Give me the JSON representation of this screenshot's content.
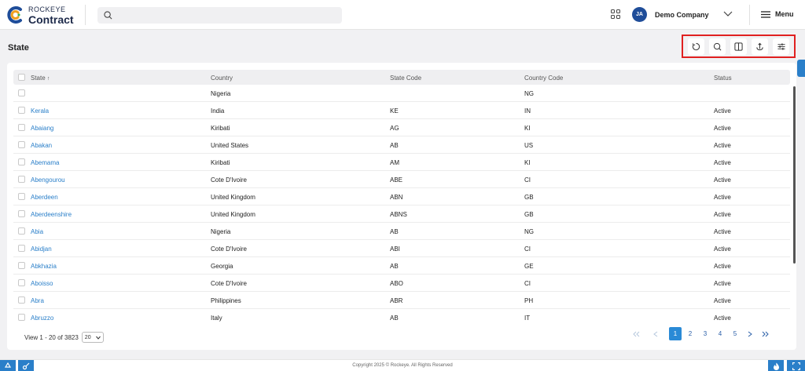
{
  "header": {
    "brand_top": "ROCKEYE",
    "brand_bottom": "Contract",
    "search_placeholder": "",
    "avatar_initials": "JA",
    "company": "Demo Company",
    "menu_label": "Menu"
  },
  "page": {
    "title": "State"
  },
  "table": {
    "columns": [
      "State",
      "Country",
      "State Code",
      "Country Code",
      "Status"
    ],
    "sort_indicator": "↑",
    "rows": [
      [
        "",
        "Nigeria",
        "",
        "NG",
        ""
      ],
      [
        "Kerala",
        "India",
        "KE",
        "IN",
        "Active"
      ],
      [
        "Abaiang",
        "Kiribati",
        "AG",
        "KI",
        "Active"
      ],
      [
        "Abakan",
        "United States",
        "AB",
        "US",
        "Active"
      ],
      [
        "Abemama",
        "Kiribati",
        "AM",
        "KI",
        "Active"
      ],
      [
        "Abengourou",
        "Cote D'Ivoire",
        "ABE",
        "CI",
        "Active"
      ],
      [
        "Aberdeen",
        "United Kingdom",
        "ABN",
        "GB",
        "Active"
      ],
      [
        "Aberdeenshire",
        "United Kingdom",
        "ABNS",
        "GB",
        "Active"
      ],
      [
        "Abia",
        "Nigeria",
        "AB",
        "NG",
        "Active"
      ],
      [
        "Abidjan",
        "Cote D'Ivoire",
        "ABI",
        "CI",
        "Active"
      ],
      [
        "Abkhazia",
        "Georgia",
        "AB",
        "GE",
        "Active"
      ],
      [
        "Aboisso",
        "Cote D'Ivoire",
        "ABO",
        "CI",
        "Active"
      ],
      [
        "Abra",
        "Philippines",
        "ABR",
        "PH",
        "Active"
      ],
      [
        "Abruzzo",
        "Italy",
        "AB",
        "IT",
        "Active"
      ]
    ]
  },
  "footer": {
    "view_text": "View 1 - 20 of 3823",
    "per_page": "20",
    "pages": [
      "1",
      "2",
      "3",
      "4",
      "5"
    ],
    "copyright": "Copyright 2025 © Rockeye. All Rights Reserved"
  },
  "colors": {
    "accent": "#2a8ad6",
    "link": "#2a7fc9",
    "highlight_border": "#e02020"
  }
}
